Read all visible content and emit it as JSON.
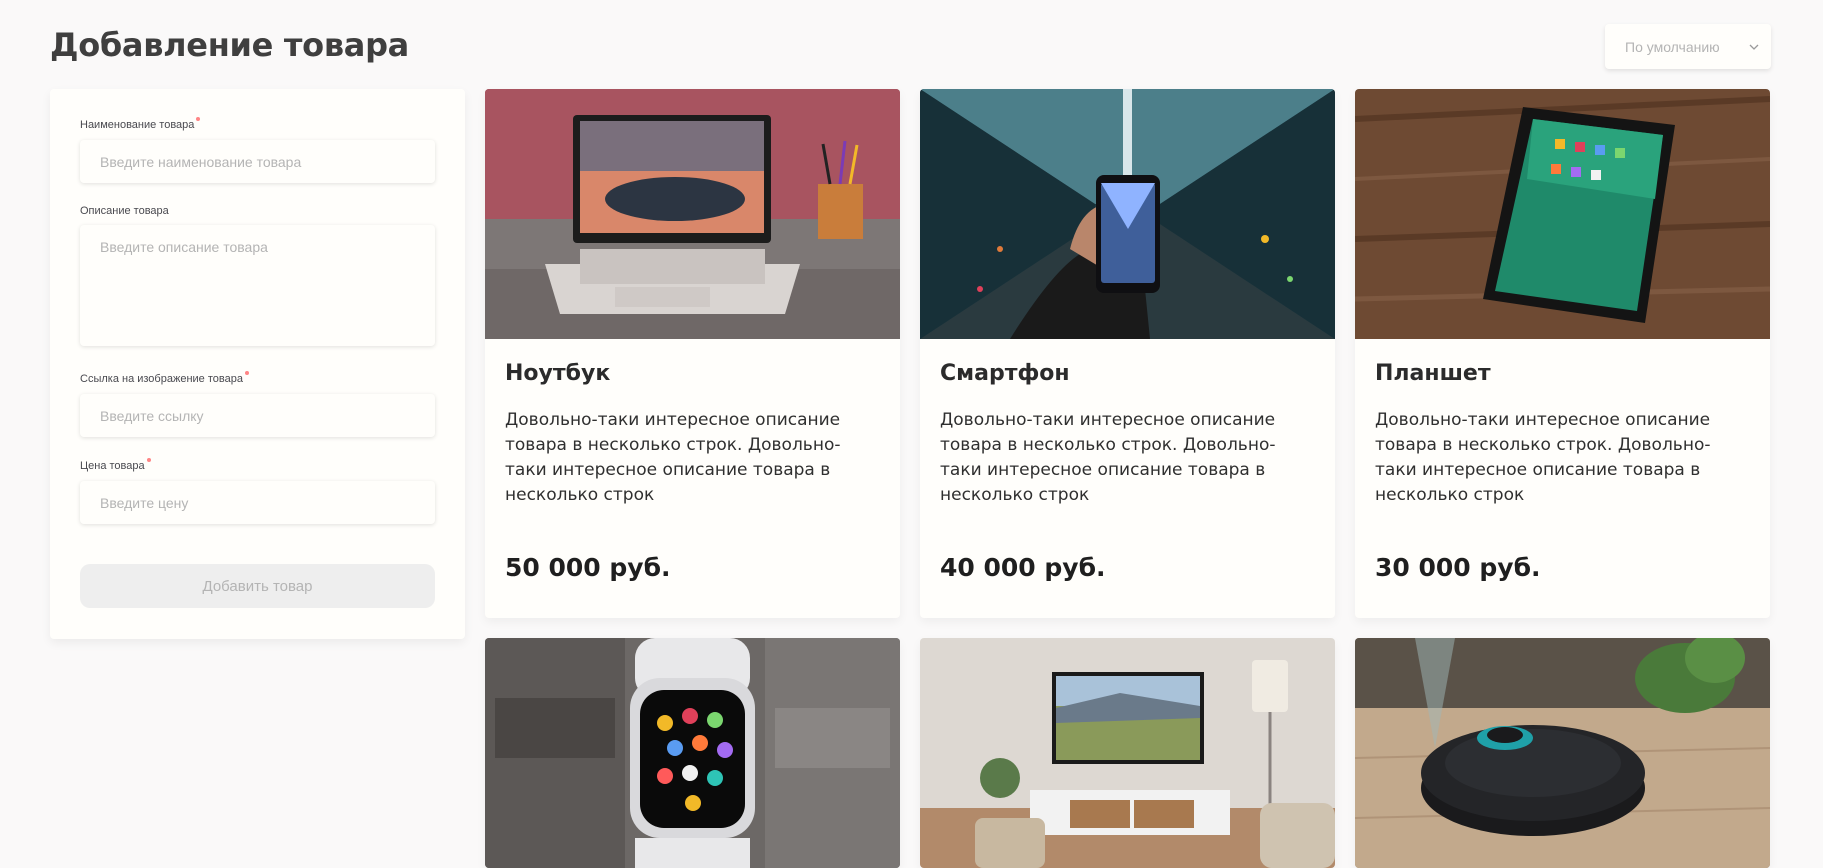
{
  "page": {
    "title": "Добавление товара"
  },
  "sort": {
    "selected": "По умолчанию",
    "icon": "chevron-down-icon"
  },
  "form": {
    "name": {
      "label": "Наименование товара",
      "placeholder": "Введите наименование товара",
      "value": ""
    },
    "description": {
      "label": "Описание товара",
      "placeholder": "Введите описание товара",
      "value": ""
    },
    "image_link": {
      "label": "Ссылка на изображение товара",
      "placeholder": "Введите ссылку",
      "value": ""
    },
    "price": {
      "label": "Цена товара",
      "placeholder": "Введите цену",
      "value": ""
    },
    "submit_label": "Добавить товар"
  },
  "products": [
    {
      "name": "Ноутбук",
      "description": "Довольно-таки интересное описание товара в несколько строк. Довольно-таки интересное описание товара в несколько строк",
      "price": "50 000 руб.",
      "image": "laptop-photo"
    },
    {
      "name": "Смартфон",
      "description": "Довольно-таки интересное описание товара в несколько строк. Довольно-таки интересное описание товара в несколько строк",
      "price": "40 000 руб.",
      "image": "smartphone-photo"
    },
    {
      "name": "Планшет",
      "description": "Довольно-таки интересное описание товара в несколько строк. Довольно-таки интересное описание товара в несколько строк",
      "price": "30 000 руб.",
      "image": "tablet-photo"
    },
    {
      "image": "smartwatch-photo"
    },
    {
      "image": "tv-living-room-photo"
    },
    {
      "image": "robot-vacuum-photo"
    }
  ],
  "colors": {
    "required_dot": "#ff8585",
    "background": "#faf9f9",
    "card": "#fffefb",
    "placeholder": "#b4b4b4"
  }
}
